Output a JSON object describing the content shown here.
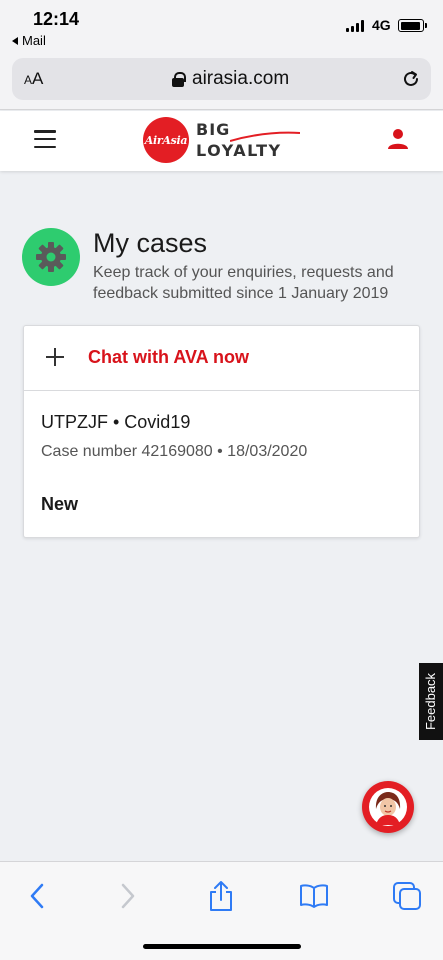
{
  "status_bar": {
    "time": "12:14",
    "back_app": "Mail",
    "network": "4G"
  },
  "browser": {
    "text_size_label": "AA",
    "url": "airasia.com"
  },
  "site_header": {
    "logo_mark": "AirAsia",
    "logo_word_1": "BIG",
    "logo_word_2": "LOYALTY",
    "brand_color": "#e31e24"
  },
  "page": {
    "title": "My cases",
    "subtitle": "Keep track of your enquiries, requests and feedback submitted since 1 January 2019",
    "chat_label": "Chat with AVA now",
    "cases": [
      {
        "name": "UTPZJF • Covid19",
        "meta": "Case number 42169080 • 18/03/2020",
        "status": "New"
      }
    ]
  },
  "feedback_tab": {
    "label": "Feedback"
  },
  "icons": {
    "menu": "hamburger-icon",
    "user": "user-icon",
    "gear": "gear-icon",
    "add": "plus-icon",
    "back": "back-icon",
    "forward": "forward-icon",
    "share": "share-icon",
    "bookmarks": "book-icon",
    "tabs": "tabs-icon",
    "reload": "reload-icon",
    "lock": "lock-icon"
  },
  "colors": {
    "accent_red": "#d8131b",
    "gear_green": "#2ecc6f",
    "ios_blue": "#2f7bf5"
  }
}
